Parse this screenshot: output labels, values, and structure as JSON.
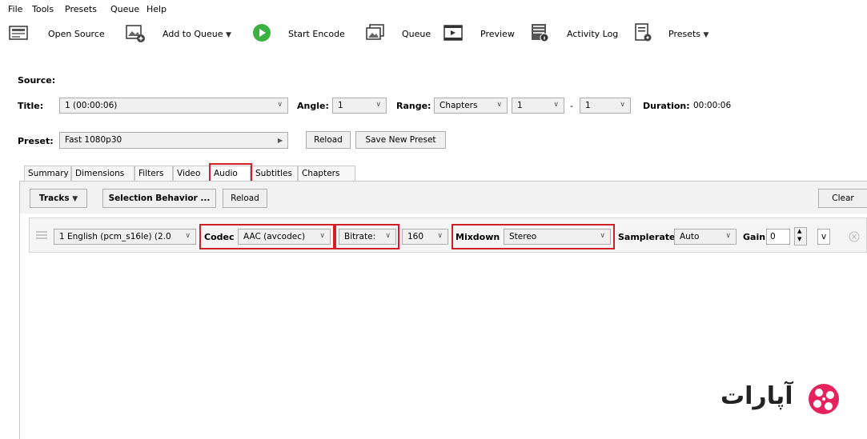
{
  "menu": [
    "File",
    "Tools",
    "Presets",
    "Queue",
    "Help"
  ],
  "toolbar": {
    "open_source": "Open Source",
    "add_to_queue": "Add to Queue",
    "start_encode": "Start Encode",
    "queue": "Queue",
    "preview": "Preview",
    "activity_log": "Activity Log",
    "presets": "Presets"
  },
  "source": {
    "label": "Source:",
    "title_label": "Title:",
    "title_value": "1 (00:00:06)",
    "angle_label": "Angle:",
    "angle_value": "1",
    "range_label": "Range:",
    "range_mode": "Chapters",
    "range_start": "1",
    "range_sep": "-",
    "range_end": "1",
    "duration_label": "Duration:",
    "duration_value": "00:00:06"
  },
  "preset": {
    "label": "Preset:",
    "value": "Fast 1080p30",
    "reload": "Reload",
    "save_new": "Save New Preset"
  },
  "tabs": [
    "Summary",
    "Dimensions",
    "Filters",
    "Video",
    "Audio",
    "Subtitles",
    "Chapters"
  ],
  "active_tab": "Audio",
  "audio": {
    "tracks_btn": "Tracks",
    "selection_behavior_btn": "Selection Behavior ...",
    "reload_btn": "Reload",
    "clear_btn": "Clear",
    "track": {
      "source": "1 English (pcm_s16le) (2.0",
      "codec_label": "Codec",
      "codec_value": "AAC (avcodec)",
      "bitrate_mode": "Bitrate:",
      "bitrate_value": "160",
      "mixdown_label": "Mixdown",
      "mixdown_value": "Stereo",
      "samplerate_label": "Samplerate",
      "samplerate_value": "Auto",
      "gain_label": "Gain",
      "gain_value": "0",
      "extra_dropdown": "v"
    }
  },
  "watermark": "آپارات",
  "colors": {
    "highlight": "#d11f26",
    "start_encode_green": "#3cb043",
    "logo_pink": "#e5245e"
  }
}
